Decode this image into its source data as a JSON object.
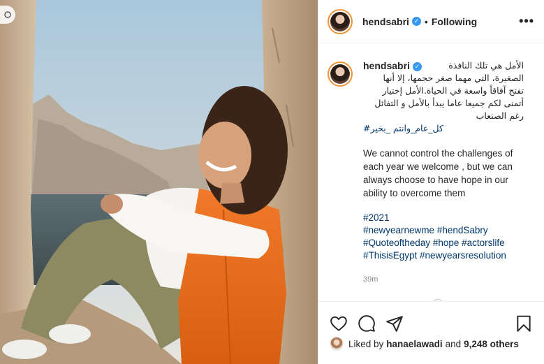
{
  "post": {
    "username": "hendsabri",
    "follow_state": "Following",
    "more_label": "•••",
    "caption_arabic": [
      "الأمل هي تلك النافذة",
      "الصغيرة، التي مهما صغر حجمها، إلا أنها",
      "تفتح آفاقاً واسعة في الحياة.الأمل إختيار",
      "أتمنى لكم جميعا عاما يبدأ بالأمل و التفائل",
      "رغم الصتعاب"
    ],
    "caption_arabic_hashtag": "#كل_عام_وانتم _بخير",
    "caption_english": "We cannot control the challenges of each year we welcome , but we can always choose to have hope in our ability to overcome them",
    "hashtags": [
      "#2021",
      "#newyearnewme #hendSabry",
      "#Quoteoftheday #hope #actorslife",
      "#ThisisEgypt #newyearsresolution"
    ],
    "timestamp": "39m",
    "liked_by_prefix": "Liked by",
    "liked_by_user": "hanaelawadi",
    "liked_by_and": "and",
    "liked_by_others": "9,248 others"
  },
  "icons": {
    "like": "heart-icon",
    "comment": "comment-icon",
    "share": "paper-plane-icon",
    "save": "bookmark-icon",
    "verified": "verified-badge-icon"
  },
  "colors": {
    "link": "#00376b",
    "verified": "#3897f0",
    "muted": "#8e8e8e"
  }
}
